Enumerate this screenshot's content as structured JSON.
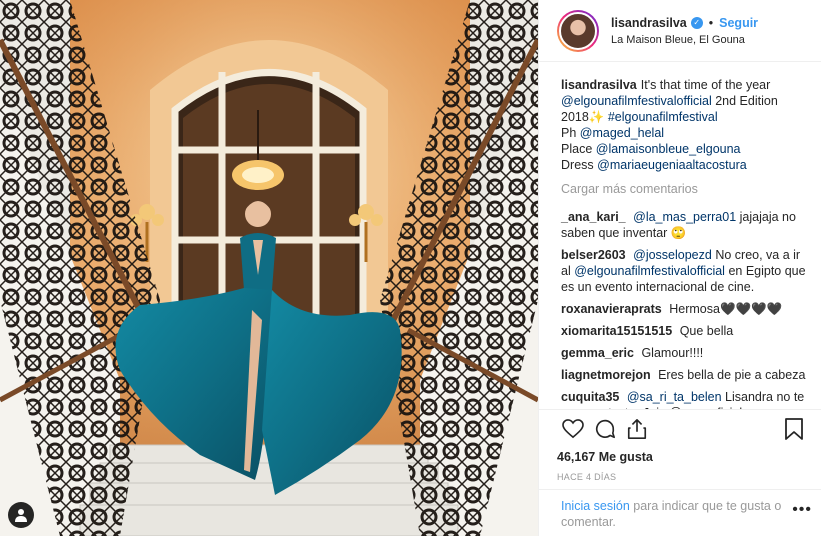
{
  "header": {
    "username": "lisandrasilva",
    "verified_glyph": "✓",
    "dot": "•",
    "follow_label": "Seguir",
    "location": "La Maison Bleue, El Gouna"
  },
  "caption": {
    "username": "lisandrasilva",
    "text1": "It's that time of the year",
    "mention1": "@elgounafilmfestivalofficial",
    "text2": "2nd Edition 2018✨",
    "hashtag": "#elgounafilmfestival",
    "ph_label": "Ph",
    "mention2": "@maged_helal",
    "place_label": "Place",
    "mention3": "@lamaisonbleue_elgouna",
    "dress_label": "Dress",
    "mention4": "@mariaeugeniaaltacostura"
  },
  "load_more": "Cargar más comentarios",
  "comments": [
    {
      "user": "_ana_kari_",
      "mention": "@la_mas_perra01",
      "text": "jajajaja no saben que inventar 🙄"
    },
    {
      "user": "belser2603",
      "mention": "@josselopezd",
      "text": "No creo, va a ir al",
      "mention2": "@elgounafilmfestivalofficial",
      "text2": "en Egipto que es un evento internacional de cine."
    },
    {
      "user": "roxanavieraprats",
      "text": "Hermosa🖤🖤🖤🖤"
    },
    {
      "user": "xiomarita15151515",
      "text": "Que bella"
    },
    {
      "user": "gemma_eric",
      "text": "Glamour!!!!"
    },
    {
      "user": "liagnetmorejon",
      "text": "Eres bella de pie a cabeza"
    },
    {
      "user": "cuquita35",
      "mention": "@sa_ri_ta_belen",
      "text": "Lisandra no te va a contestar Jaja 😉 superficial por que"
    }
  ],
  "actions": {
    "likes": "46,167 Me gusta",
    "time": "HACE 4 DÍAS"
  },
  "login": {
    "link": "Inicia sesión",
    "text": "para indicar que te gusta o comentar.",
    "more": "•••"
  },
  "colors": {
    "accent": "#3897f0",
    "link": "#003569",
    "muted": "#999999",
    "dress": "#0e6f86"
  }
}
